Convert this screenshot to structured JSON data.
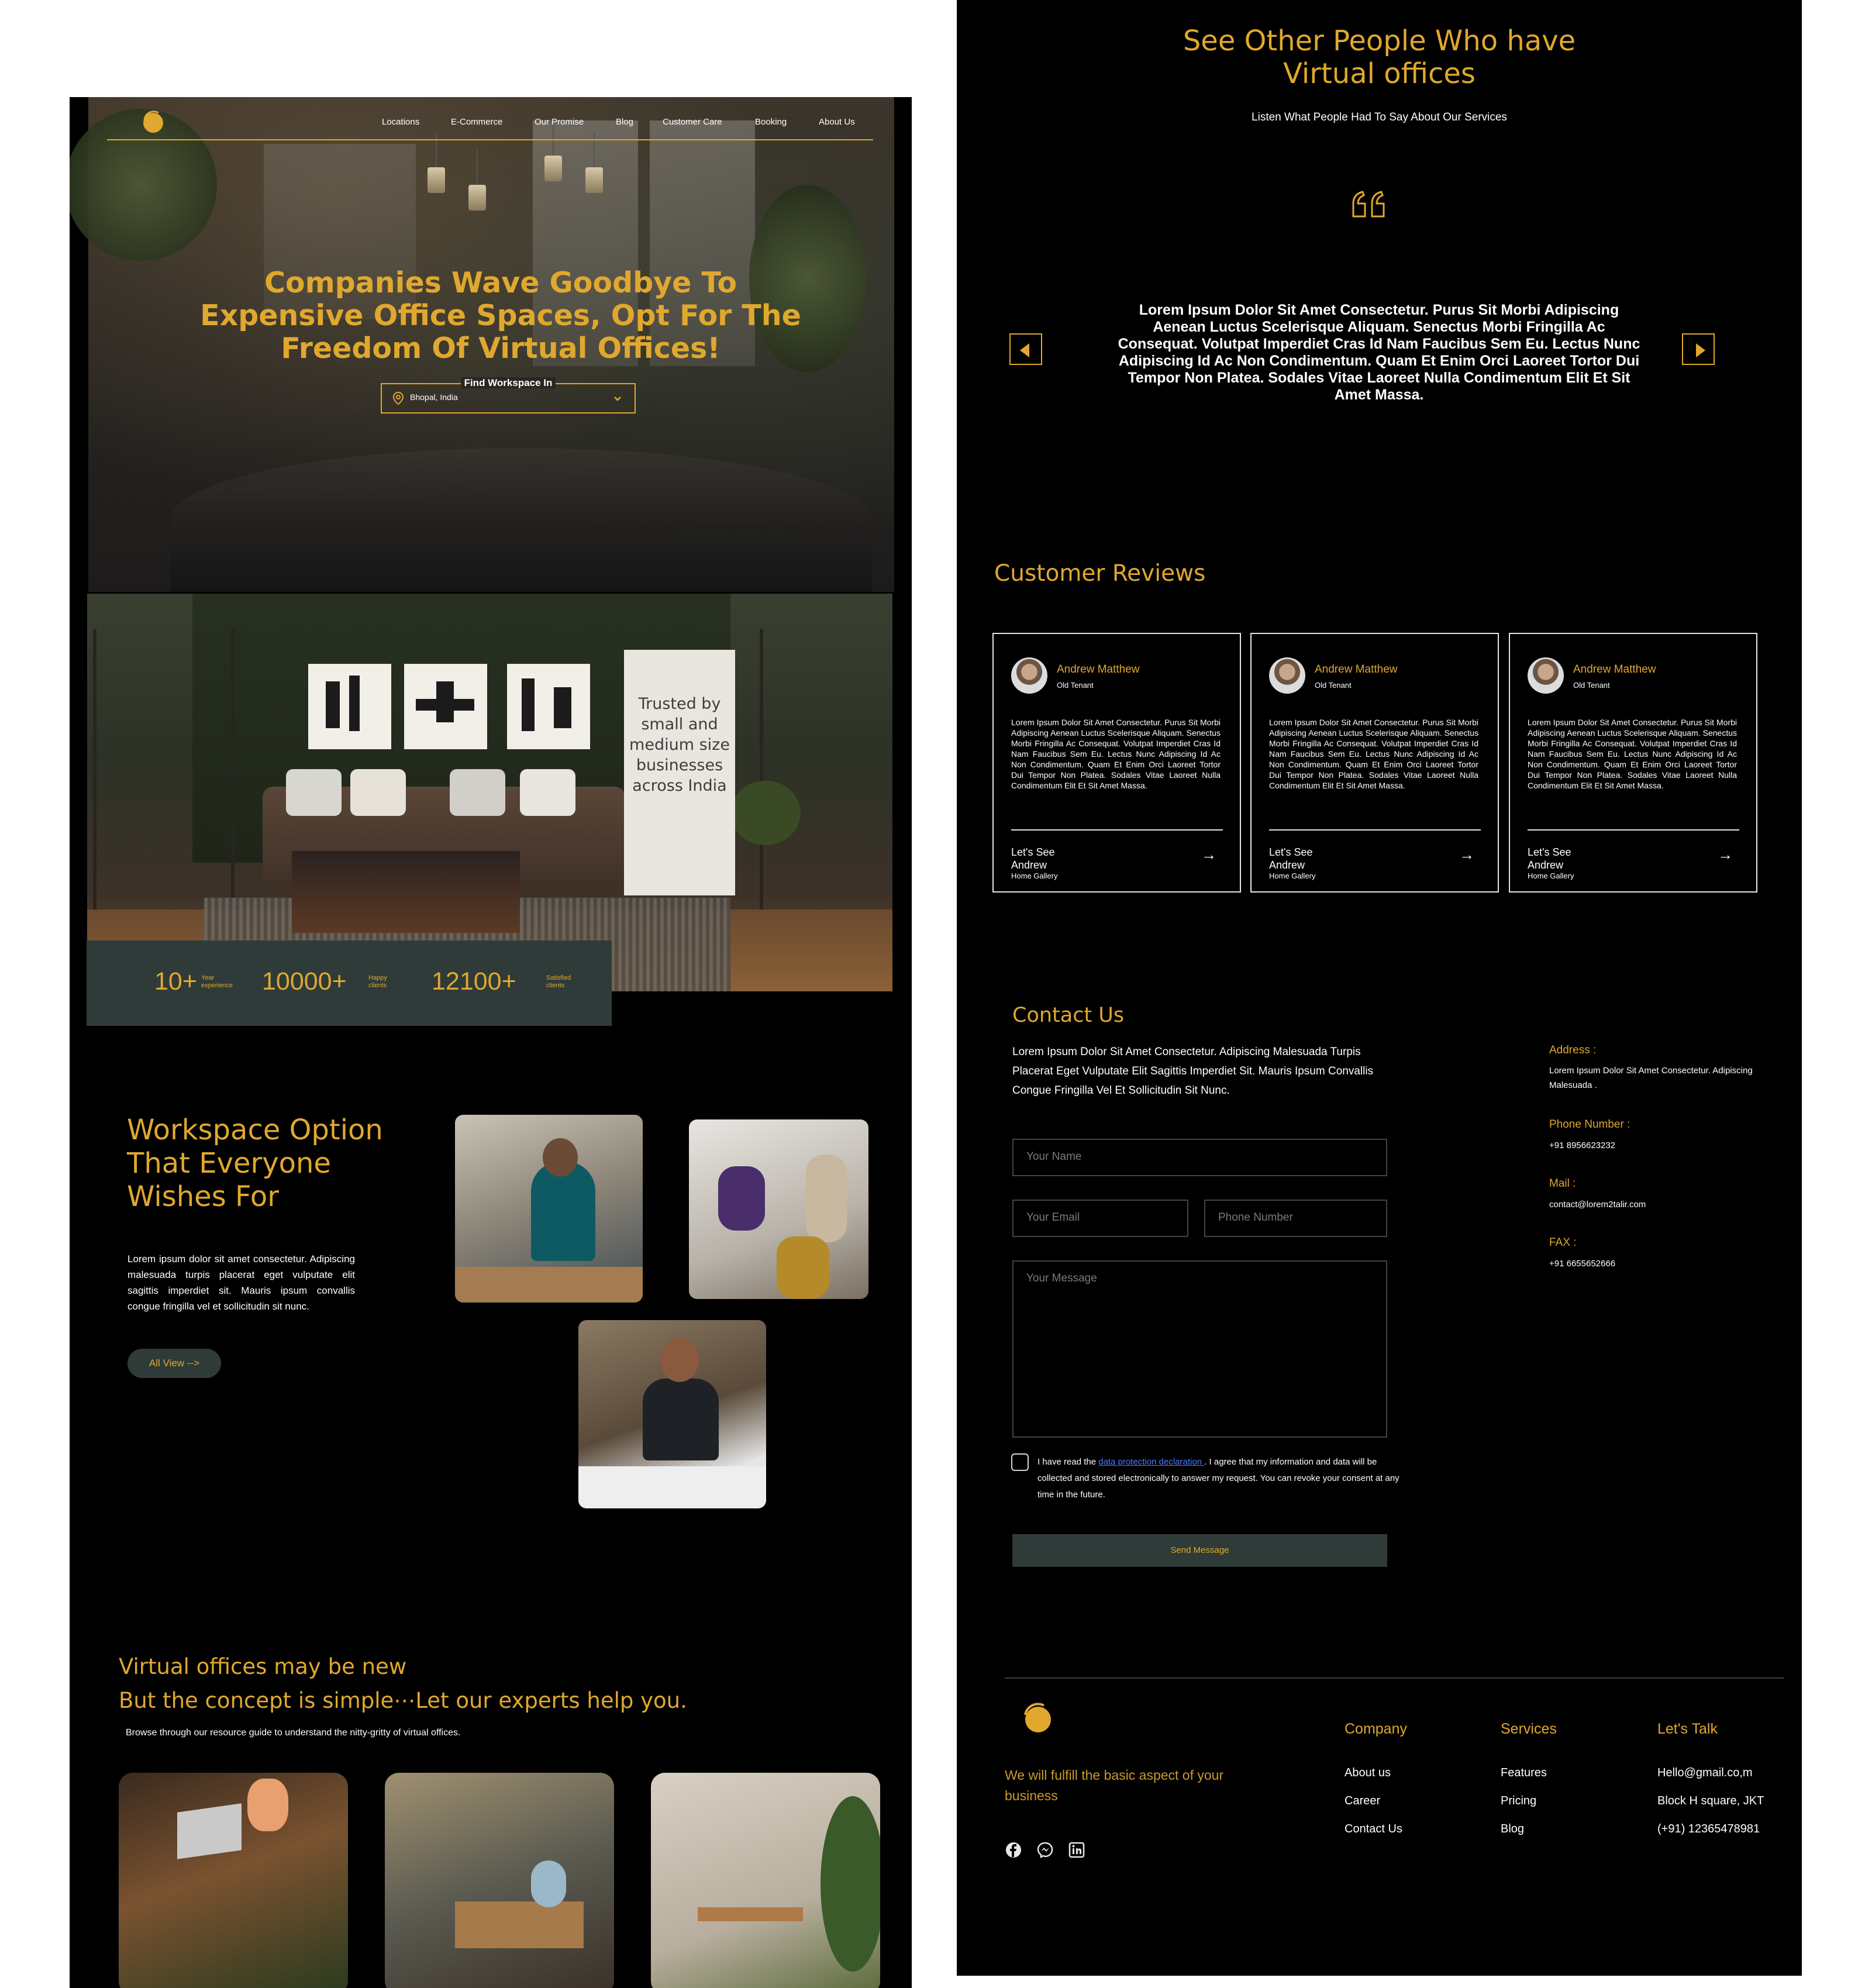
{
  "nav": {
    "items": [
      "Locations",
      "E-Commerce",
      "Our Promise",
      "Blog",
      "Customer Care",
      "Booking",
      "About Us"
    ]
  },
  "hero": {
    "title": "Companies Wave Goodbye To Expensive Office Spaces, Opt For The Freedom Of Virtual Offices!",
    "find_label": "Find Workspace In",
    "location_value": "Bhopal, India"
  },
  "banner": {
    "text": "Trusted by small and medium size businesses across India"
  },
  "stats": [
    {
      "num": "10+",
      "label1": "Year",
      "label2": "experience"
    },
    {
      "num": "10000+",
      "label1": "Happy",
      "label2": "clients"
    },
    {
      "num": "12100+",
      "label1": "Satisfied",
      "label2": "clients"
    }
  ],
  "workspace": {
    "title_lines": [
      "Workspace Option",
      "That Everyone",
      "Wishes For"
    ],
    "body": "Lorem ipsum dolor sit amet consectetur. Adipiscing malesuada turpis placerat eget vulputate elit sagittis imperdiet sit. Mauris ipsum convallis congue fringilla vel et sollicitudin sit nunc.",
    "button": "All View -->"
  },
  "virtual": {
    "line1": "Virtual offices may be new",
    "line2": "But the concept is simple⋯Let our experts help you.",
    "sub": "Browse through our resource guide to understand the nitty-gritty of virtual offices."
  },
  "testimonials": {
    "title_line1": "See Other People Who have",
    "title_line2": "Virtual offices",
    "subtitle": "Listen What People Had To Say About Our Services",
    "quote": "Lorem Ipsum Dolor Sit Amet Consectetur. Purus Sit Morbi Adipiscing Aenean Luctus Scelerisque Aliquam. Senectus Morbi Fringilla Ac Consequat. Volutpat Imperdiet Cras Id Nam Faucibus Sem Eu. Lectus Nunc Adipiscing Id Ac Non Condimentum. Quam Et Enim Orci Laoreet Tortor Dui Tempor Non Platea. Sodales Vitae Laoreet Nulla Condimentum Elit Et Sit Amet Massa."
  },
  "reviews": {
    "title": "Customer Reviews",
    "items": [
      {
        "name": "Andrew Matthew",
        "role": "Old Tenant",
        "body": "Lorem Ipsum Dolor Sit Amet Consectetur. Purus Sit Morbi Adipiscing Aenean Luctus Scelerisque Aliquam. Senectus Morbi Fringilla Ac Consequat. Volutpat Imperdiet Cras Id Nam Faucibus Sem Eu. Lectus Nunc Adipiscing Id Ac Non Condimentum. Quam Et Enim Orci Laoreet Tortor Dui Tempor Non Platea. Sodales Vitae Laoreet Nulla Condimentum Elit Et Sit Amet Massa.",
        "lets": "Let's See",
        "who": "Andrew",
        "gallery": "Home Gallery"
      },
      {
        "name": "Andrew Matthew",
        "role": "Old Tenant",
        "body": "Lorem Ipsum Dolor Sit Amet Consectetur. Purus Sit Morbi Adipiscing Aenean Luctus Scelerisque Aliquam. Senectus Morbi Fringilla Ac Consequat. Volutpat Imperdiet Cras Id Nam Faucibus Sem Eu. Lectus Nunc Adipiscing Id Ac Non Condimentum. Quam Et Enim Orci Laoreet Tortor Dui Tempor Non Platea. Sodales Vitae Laoreet Nulla Condimentum Elit Et Sit Amet Massa.",
        "lets": "Let's See",
        "who": "Andrew",
        "gallery": "Home Gallery"
      },
      {
        "name": "Andrew Matthew",
        "role": "Old Tenant",
        "body": "Lorem Ipsum Dolor Sit Amet Consectetur. Purus Sit Morbi Adipiscing Aenean Luctus Scelerisque Aliquam. Senectus Morbi Fringilla Ac Consequat. Volutpat Imperdiet Cras Id Nam Faucibus Sem Eu. Lectus Nunc Adipiscing Id Ac Non Condimentum. Quam Et Enim Orci Laoreet Tortor Dui Tempor Non Platea. Sodales Vitae Laoreet Nulla Condimentum Elit Et Sit Amet Massa.",
        "lets": "Let's See",
        "who": "Andrew",
        "gallery": "Home Gallery"
      }
    ]
  },
  "contact": {
    "title": "Contact Us",
    "body": "Lorem Ipsum Dolor Sit Amet Consectetur. Adipiscing Malesuada Turpis Placerat Eget Vulputate Elit Sagittis Imperdiet Sit. Mauris Ipsum Convallis Congue Fringilla Vel Et Sollicitudin Sit Nunc.",
    "name_placeholder": "Your Name",
    "email_placeholder": "Your Email",
    "phone_placeholder": "Phone Number",
    "message_placeholder": "Your Message",
    "consent_pre": "I have read the ",
    "consent_link": "data protection declaration ",
    "consent_post": ". I agree that my information and data will be collected and stored electronically to answer my request. You can revoke your consent at any time in the future.",
    "send": "Send Message",
    "address_label": "Address :",
    "address_value": "Lorem Ipsum Dolor Sit Amet Consectetur. Adipiscing Malesuada .",
    "phone_label": "Phone Number :",
    "phone_value": "+91 8956623232",
    "mail_label": "Mail :",
    "mail_value": "contact@lorem2talir.com",
    "fax_label": "FAX :",
    "fax_value": "+91 6655652666"
  },
  "footer": {
    "tagline": "We will fulfill the basic aspect of your business",
    "company": {
      "title": "Company",
      "items": [
        "About us",
        "Career",
        "Contact Us"
      ]
    },
    "services": {
      "title": "Services",
      "items": [
        "Features",
        "Pricing",
        "Blog"
      ]
    },
    "talk": {
      "title": "Let's Talk",
      "items": [
        "Hello@gmail.co,m",
        "Block H square, JKT",
        "(+91) 12365478981"
      ]
    }
  },
  "colors": {
    "accent": "#e0a82e",
    "panel": "#000000",
    "slate": "#2f3b38"
  }
}
